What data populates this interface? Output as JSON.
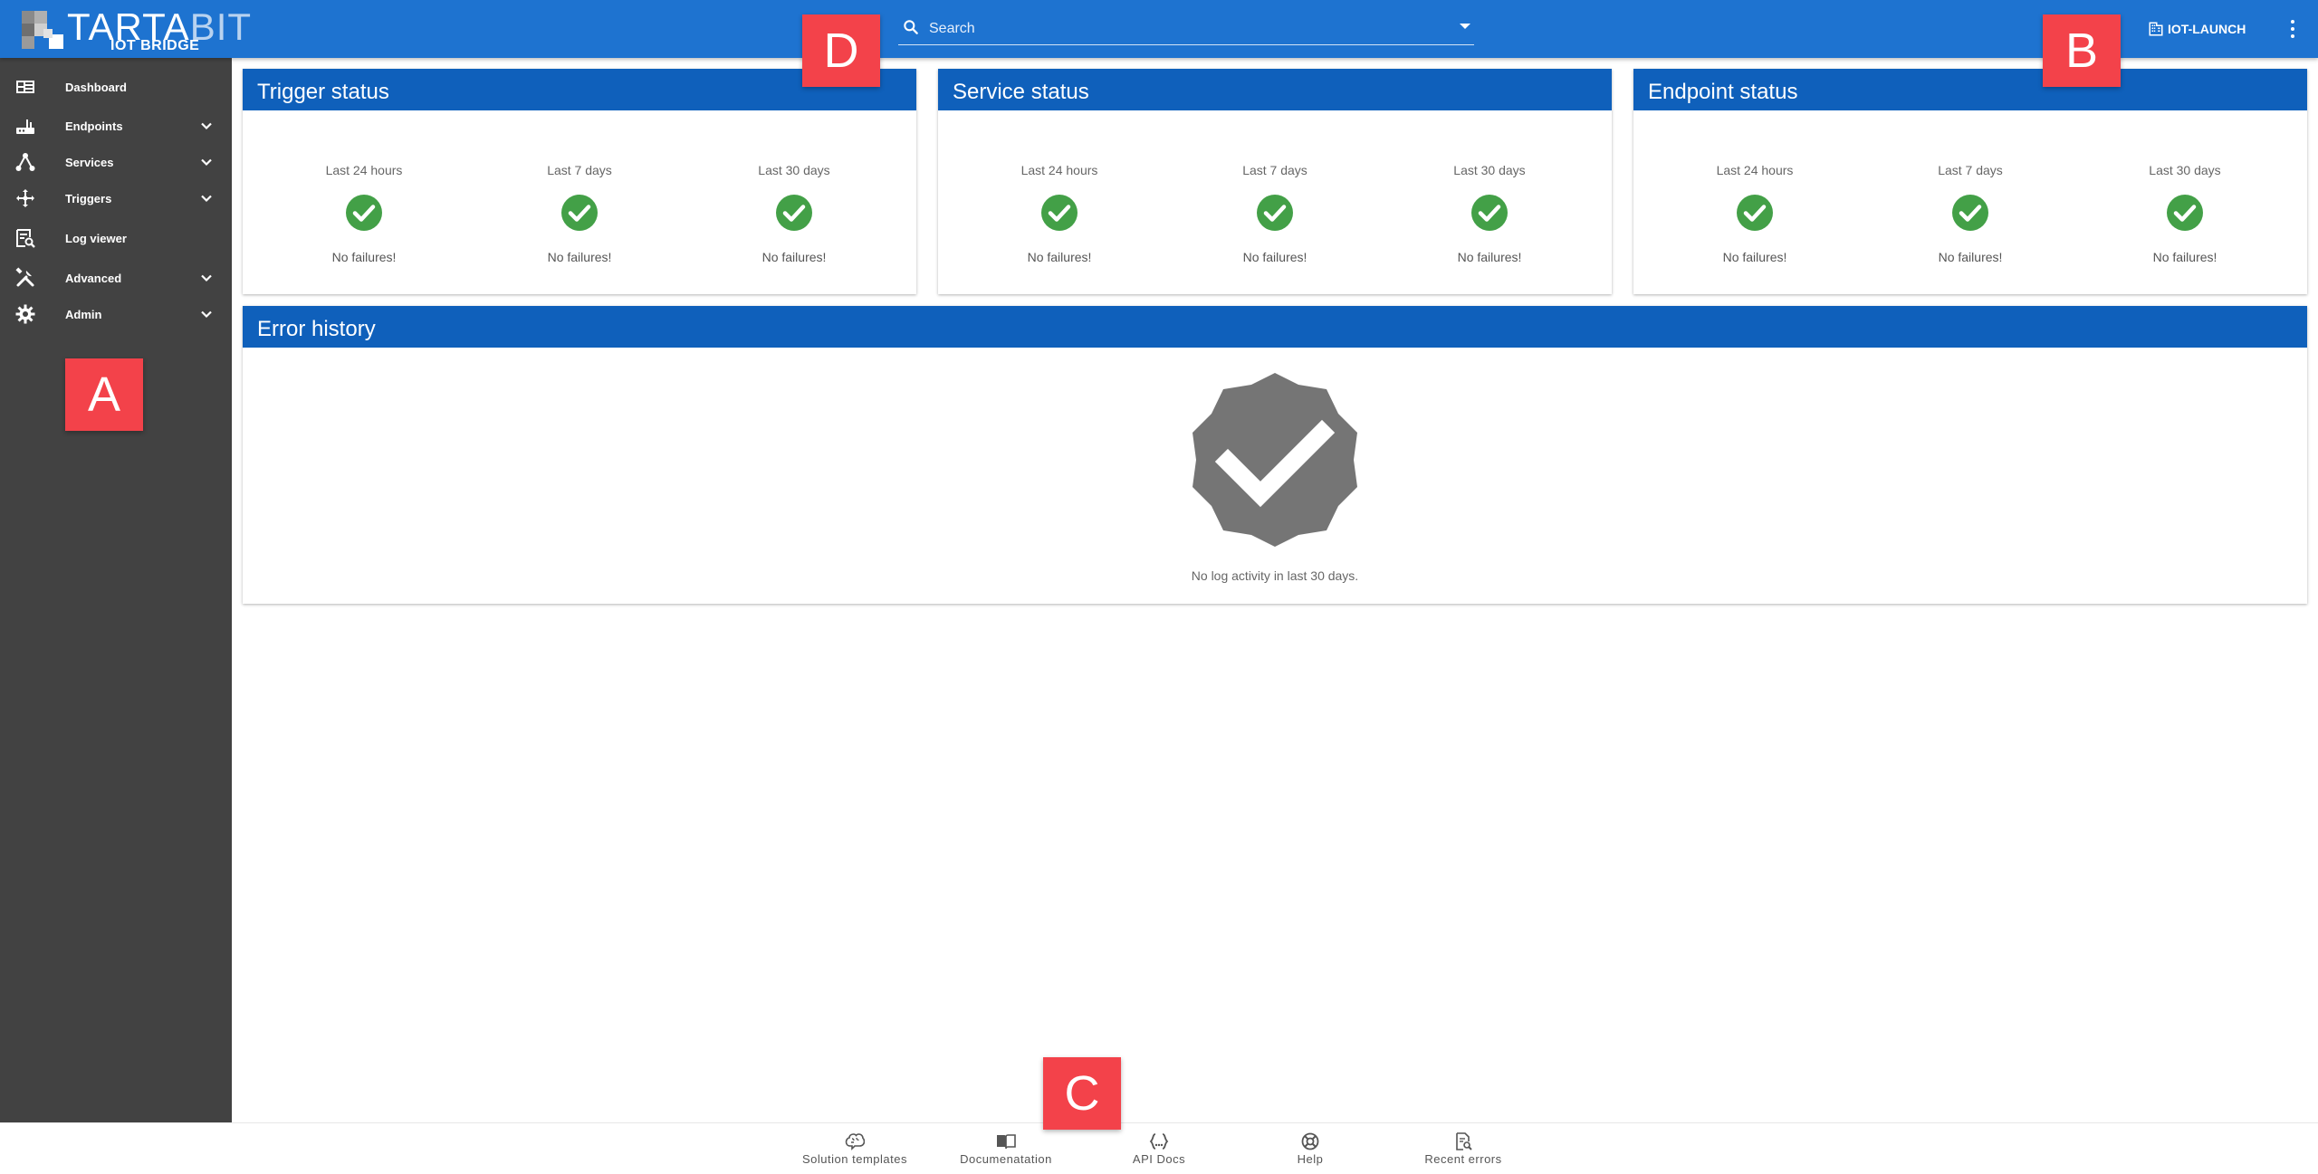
{
  "header": {
    "logo_title_main": "TARTA",
    "logo_title_accent": "BIT",
    "logo_subtitle": "IOT BRIDGE",
    "search_placeholder": "Search",
    "tenant_label": "IOT-LAUNCH",
    "accent_color": "#1e73d0"
  },
  "sidebar": {
    "background": "#424242",
    "items": [
      {
        "label": "Dashboard",
        "icon": "dashboard-icon",
        "expandable": false
      },
      {
        "label": "Endpoints",
        "icon": "router-icon",
        "expandable": true
      },
      {
        "label": "Services",
        "icon": "hub-icon",
        "expandable": true
      },
      {
        "label": "Triggers",
        "icon": "arrows-move-icon",
        "expandable": true
      },
      {
        "label": "Log viewer",
        "icon": "log-search-icon",
        "expandable": false
      },
      {
        "label": "Advanced",
        "icon": "tools-icon",
        "expandable": true
      },
      {
        "label": "Admin",
        "icon": "gear-icon",
        "expandable": true
      }
    ]
  },
  "cards": {
    "trigger": {
      "title": "Trigger status",
      "columns": [
        {
          "period": "Last 24 hours",
          "status": "No failures!"
        },
        {
          "period": "Last 7 days",
          "status": "No failures!"
        },
        {
          "period": "Last 30 days",
          "status": "No failures!"
        }
      ]
    },
    "service": {
      "title": "Service status",
      "columns": [
        {
          "period": "Last 24 hours",
          "status": "No failures!"
        },
        {
          "period": "Last 7 days",
          "status": "No failures!"
        },
        {
          "period": "Last 30 days",
          "status": "No failures!"
        }
      ]
    },
    "endpoint": {
      "title": "Endpoint status",
      "columns": [
        {
          "period": "Last 24 hours",
          "status": "No failures!"
        },
        {
          "period": "Last 7 days",
          "status": "No failures!"
        },
        {
          "period": "Last 30 days",
          "status": "No failures!"
        }
      ]
    },
    "error_history": {
      "title": "Error history",
      "message": "No log activity in last 30 days."
    }
  },
  "footer": {
    "items": [
      {
        "label": "Solution templates",
        "icon": "brain-icon"
      },
      {
        "label": "Documenatation",
        "icon": "book-icon"
      },
      {
        "label": "API Docs",
        "icon": "code-braces-icon"
      },
      {
        "label": "Help",
        "icon": "lifebuoy-icon"
      },
      {
        "label": "Recent errors",
        "icon": "file-search-icon"
      }
    ]
  },
  "markers": {
    "a": "A",
    "b": "B",
    "c": "C",
    "d": "D"
  },
  "colors": {
    "card_header": "#0f60bb",
    "success": "#43a047",
    "marker": "#f3424a",
    "badge_gray": "#757575"
  }
}
